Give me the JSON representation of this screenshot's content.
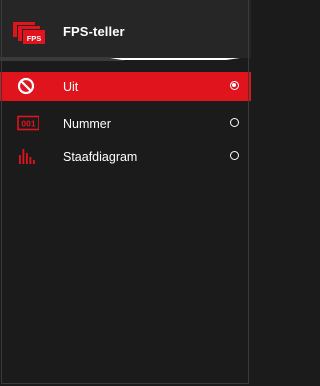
{
  "header": {
    "title": "FPS-teller",
    "icon": "fps-counter-icon",
    "icon_text": "FPS"
  },
  "options": [
    {
      "label": "Uit",
      "icon": "prohibited-icon",
      "selected": true
    },
    {
      "label": "Nummer",
      "icon": "number-counter-icon",
      "icon_text": "001",
      "selected": false
    },
    {
      "label": "Staafdiagram",
      "icon": "bar-graph-icon",
      "selected": false
    }
  ],
  "colors": {
    "accent": "#e0141c",
    "background": "#1b1b1b",
    "header_background": "#262626",
    "text": "#ffffff"
  }
}
